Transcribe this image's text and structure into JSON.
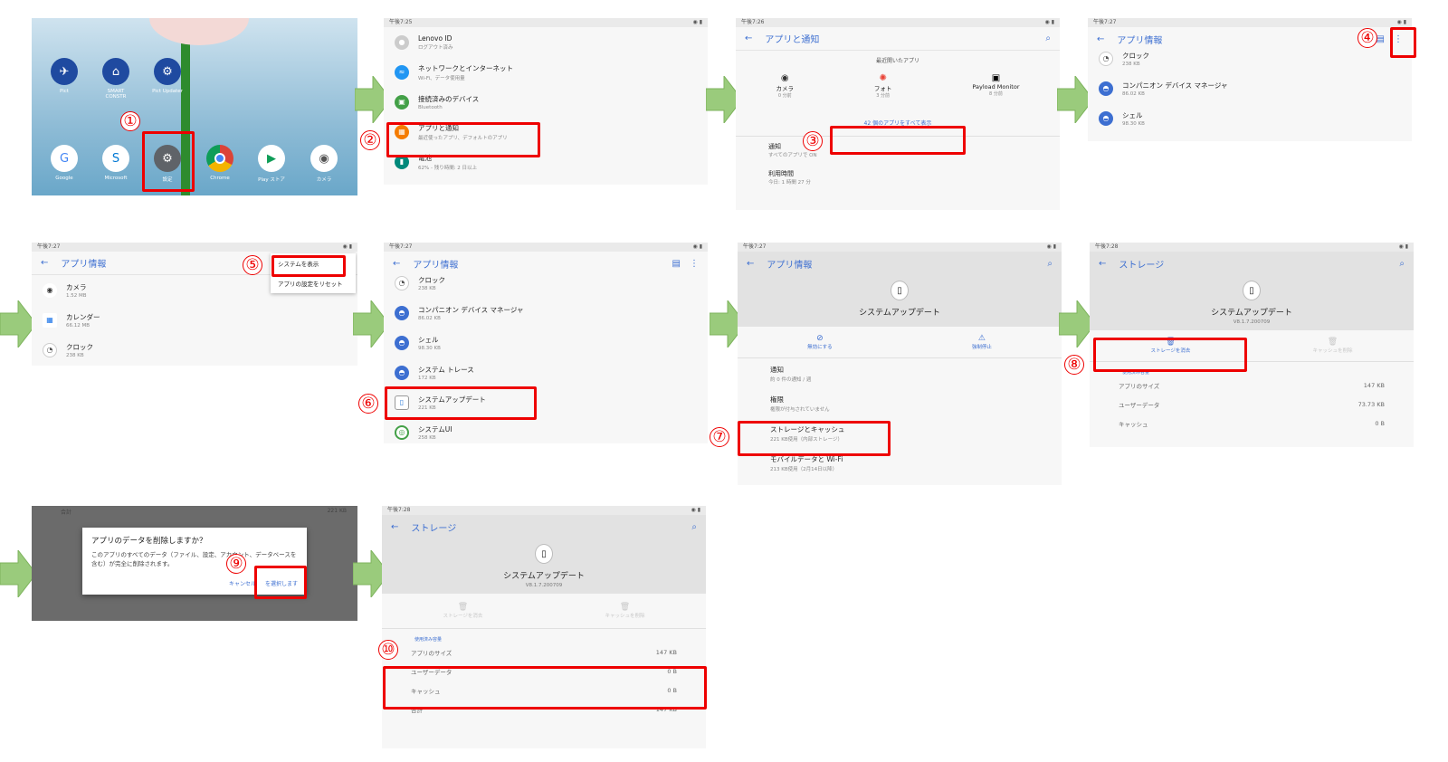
{
  "steps": {
    "s1": "①",
    "s2": "②",
    "s3": "③",
    "s4": "④",
    "s5": "⑤",
    "s6": "⑥",
    "s7": "⑦",
    "s8": "⑧",
    "s9": "⑨",
    "s10": "⑩"
  },
  "home": {
    "apps_top": [
      {
        "label": "Pict",
        "color": "#1f4aa0"
      },
      {
        "label": "SMART CONSTR",
        "color": "#1f4aa0"
      },
      {
        "label": "Pict Updater",
        "color": "#1f4aa0"
      }
    ],
    "apps_bottom": [
      {
        "label": "Google"
      },
      {
        "label": "Microsoft"
      },
      {
        "label": "設定"
      },
      {
        "label": "Chrome"
      },
      {
        "label": "Play ストア"
      },
      {
        "label": "カメラ"
      }
    ]
  },
  "p2": {
    "time": "午後7:25",
    "items": [
      {
        "title": "Lenovo ID",
        "sub": "ログアウト済み"
      },
      {
        "title": "ネットワークとインターネット",
        "sub": "Wi-Fi、データ使用量"
      },
      {
        "title": "接続済みのデバイス",
        "sub": "Bluetooth"
      },
      {
        "title": "アプリと通知",
        "sub": "最近使ったアプリ、デフォルトのアプリ"
      },
      {
        "title": "電池",
        "sub": "62% - 残り時間: 2 日以上"
      }
    ]
  },
  "p3": {
    "time": "午後7:26",
    "title": "アプリと通知",
    "recent": "最近開いたアプリ",
    "apps": [
      {
        "name": "カメラ",
        "sub": "0 分前"
      },
      {
        "name": "フォト",
        "sub": "3 分前"
      },
      {
        "name": "Payload Monitor",
        "sub": "8 分前"
      }
    ],
    "see_all": "42 個のアプリをすべて表示",
    "notif_title": "通知",
    "notif_sub": "すべてのアプリで ON",
    "usage_title": "利用時間",
    "usage_sub": "今日: 1 時間 27 分"
  },
  "p4": {
    "time": "午後7:27",
    "title": "アプリ情報",
    "items": [
      {
        "title": "クロック",
        "sub": "238 KB"
      },
      {
        "title": "コンパニオン デバイス マネージャ",
        "sub": "86.02 KB"
      },
      {
        "title": "シェル",
        "sub": "98.30 KB"
      }
    ]
  },
  "p5": {
    "time": "午後7:27",
    "title": "アプリ情報",
    "menu": [
      "システムを表示",
      "アプリの設定をリセット"
    ],
    "items": [
      {
        "title": "カメラ",
        "sub": "1.52 MB"
      },
      {
        "title": "カレンダー",
        "sub": "66.12 MB"
      },
      {
        "title": "クロック",
        "sub": "238 KB"
      }
    ]
  },
  "p6": {
    "time": "午後7:27",
    "title": "アプリ情報",
    "items": [
      {
        "title": "クロック",
        "sub": "238 KB"
      },
      {
        "title": "コンパニオン デバイス マネージャ",
        "sub": "86.02 KB"
      },
      {
        "title": "シェル",
        "sub": "98.30 KB"
      },
      {
        "title": "システム トレース",
        "sub": "172 KB"
      },
      {
        "title": "システムアップデート",
        "sub": "221 KB"
      },
      {
        "title": "システムUI",
        "sub": "258 KB"
      }
    ]
  },
  "p7": {
    "time": "午後7:27",
    "title": "アプリ情報",
    "app": "システムアップデート",
    "disable": "無効にする",
    "force_stop": "強制停止",
    "items": [
      {
        "title": "通知",
        "sub": "約 0 件の通知 / 週"
      },
      {
        "title": "権限",
        "sub": "権限が付与されていません"
      },
      {
        "title": "ストレージとキャッシュ",
        "sub": "221 KB使用（内部ストレージ）"
      },
      {
        "title": "モバイルデータと Wi-Fi",
        "sub": "213 KB使用（2月14日以降）"
      }
    ]
  },
  "p8": {
    "time": "午後7:28",
    "title": "ストレージ",
    "app": "システムアップデート",
    "version": "V8.1.7.200709",
    "clear_storage": "ストレージを消去",
    "clear_cache": "キャッシュを削除",
    "section": "使用済み容量",
    "rows": [
      {
        "k": "アプリのサイズ",
        "v": "147 KB"
      },
      {
        "k": "ユーザーデータ",
        "v": "73.73 KB"
      },
      {
        "k": "キャッシュ",
        "v": "0 B"
      }
    ]
  },
  "p9": {
    "bg_label": "合計",
    "bg_value": "221 KB",
    "title": "アプリのデータを削除しますか？",
    "body": "このアプリのすべてのデータ（ファイル、設定、アカウント、データベースを含む）が完全に削除されます。",
    "cancel": "キャンセル",
    "ok": "を選択します"
  },
  "p10": {
    "time": "午後7:28",
    "title": "ストレージ",
    "app": "システムアップデート",
    "version": "V8.1.7.200709",
    "clear_storage": "ストレージを消去",
    "clear_cache": "キャッシュを削除",
    "section": "使用済み容量",
    "rows": [
      {
        "k": "アプリのサイズ",
        "v": "147 KB"
      },
      {
        "k": "ユーザーデータ",
        "v": "0 B"
      },
      {
        "k": "キャッシュ",
        "v": "0 B"
      },
      {
        "k": "合計",
        "v": "147 KB"
      }
    ]
  }
}
